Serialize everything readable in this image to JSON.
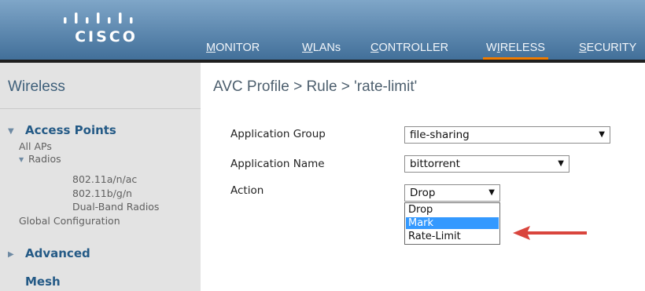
{
  "brand": {
    "logo_text": "CISCO",
    "logo_icon": "cisco-bars-logo"
  },
  "nav": {
    "items": [
      {
        "first": "M",
        "rest": "ONITOR"
      },
      {
        "first": "W",
        "rest": "LANs"
      },
      {
        "first": "C",
        "rest": "ONTROLLER"
      },
      {
        "pre": "W",
        "first": "I",
        "rest": "RELESS"
      },
      {
        "first": "S",
        "rest": "ECURITY"
      }
    ],
    "active": "WIRELESS",
    "active_color": "#f07c00"
  },
  "sidebar": {
    "title": "Wireless",
    "access_points": {
      "label": "Access Points",
      "all_aps": "All APs",
      "radios": "Radios",
      "radio_items": [
        "802.11a/n/ac",
        "802.11b/g/n",
        "Dual-Band Radios"
      ],
      "global_config": "Global Configuration"
    },
    "advanced": "Advanced",
    "mesh": "Mesh"
  },
  "main": {
    "breadcrumb": "AVC Profile > Rule > 'rate-limit'",
    "application_group": {
      "label": "Application Group",
      "value": "file-sharing"
    },
    "application_name": {
      "label": "Application Name",
      "value": "bittorrent"
    },
    "action": {
      "label": "Action",
      "value": "Drop",
      "options": [
        "Drop",
        "Mark",
        "Rate-Limit"
      ],
      "highlighted": "Mark"
    }
  },
  "colors": {
    "header_blue": "#5b86ad",
    "sidebar_bg": "#e3e3e3",
    "highlight_blue": "#3399ff",
    "annotation_red": "#d9453d"
  }
}
